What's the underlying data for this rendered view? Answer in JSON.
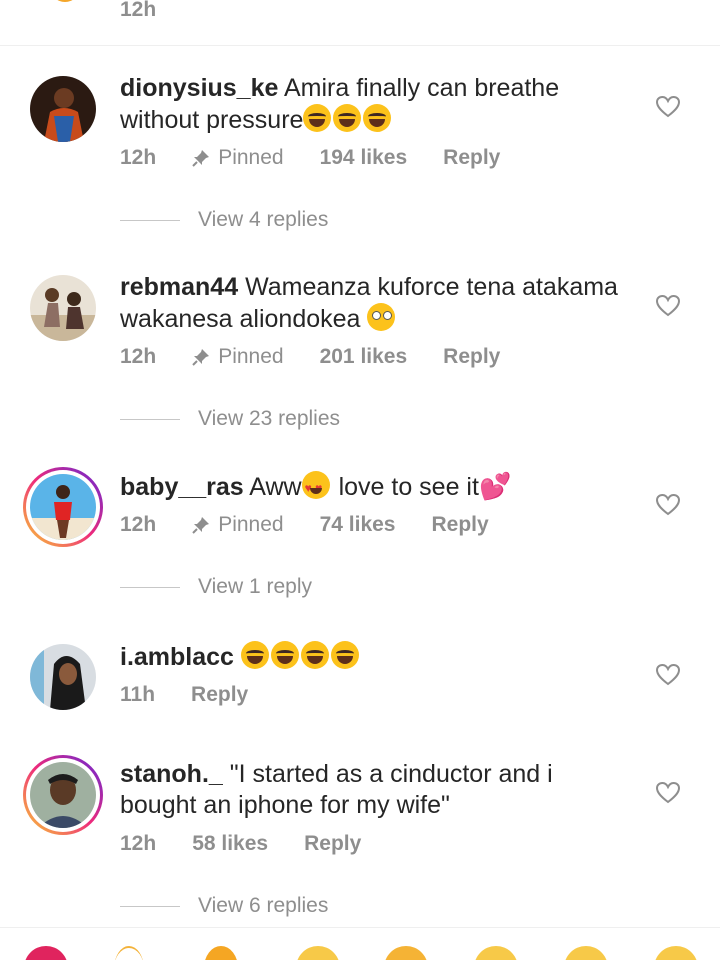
{
  "prev_comment": {
    "time": "12h"
  },
  "comments": [
    {
      "username": "dionysius_ke",
      "text": "Amira finally can breathe without pressure",
      "emojis": [
        "laugh",
        "laugh",
        "laugh"
      ],
      "time": "12h",
      "pinned": "Pinned",
      "likes": "194 likes",
      "reply": "Reply",
      "view_replies": "View 4 replies"
    },
    {
      "username": "rebman44",
      "text": "Wameanza kuforce tena atakama wakanesa aliondokea",
      "emojis": [
        "eyeroll"
      ],
      "time": "12h",
      "pinned": "Pinned",
      "likes": "201 likes",
      "reply": "Reply",
      "view_replies": "View 23 replies"
    },
    {
      "username": "baby__ras",
      "text_before": "Aww",
      "text_after": "love to see it",
      "emojis": [
        "hearteyes",
        "twohearts"
      ],
      "time": "12h",
      "pinned": "Pinned",
      "likes": "74 likes",
      "reply": "Reply",
      "view_replies": "View 1 reply"
    },
    {
      "username": "i.amblacc",
      "emojis": [
        "laugh",
        "laugh",
        "laugh",
        "laugh"
      ],
      "time": "11h",
      "reply": "Reply"
    },
    {
      "username": "stanoh._",
      "text": "\"I started as a cinductor and i bought an iphone for my wife\"",
      "time": "12h",
      "likes": "58 likes",
      "reply": "Reply",
      "view_replies": "View 6 replies"
    }
  ],
  "icons": {
    "heart": "heart-outline-icon",
    "pin": "pin-icon"
  },
  "colors": {
    "text": "#262626",
    "meta": "#8e8e8e",
    "story_ring": "#ee2a7b"
  }
}
